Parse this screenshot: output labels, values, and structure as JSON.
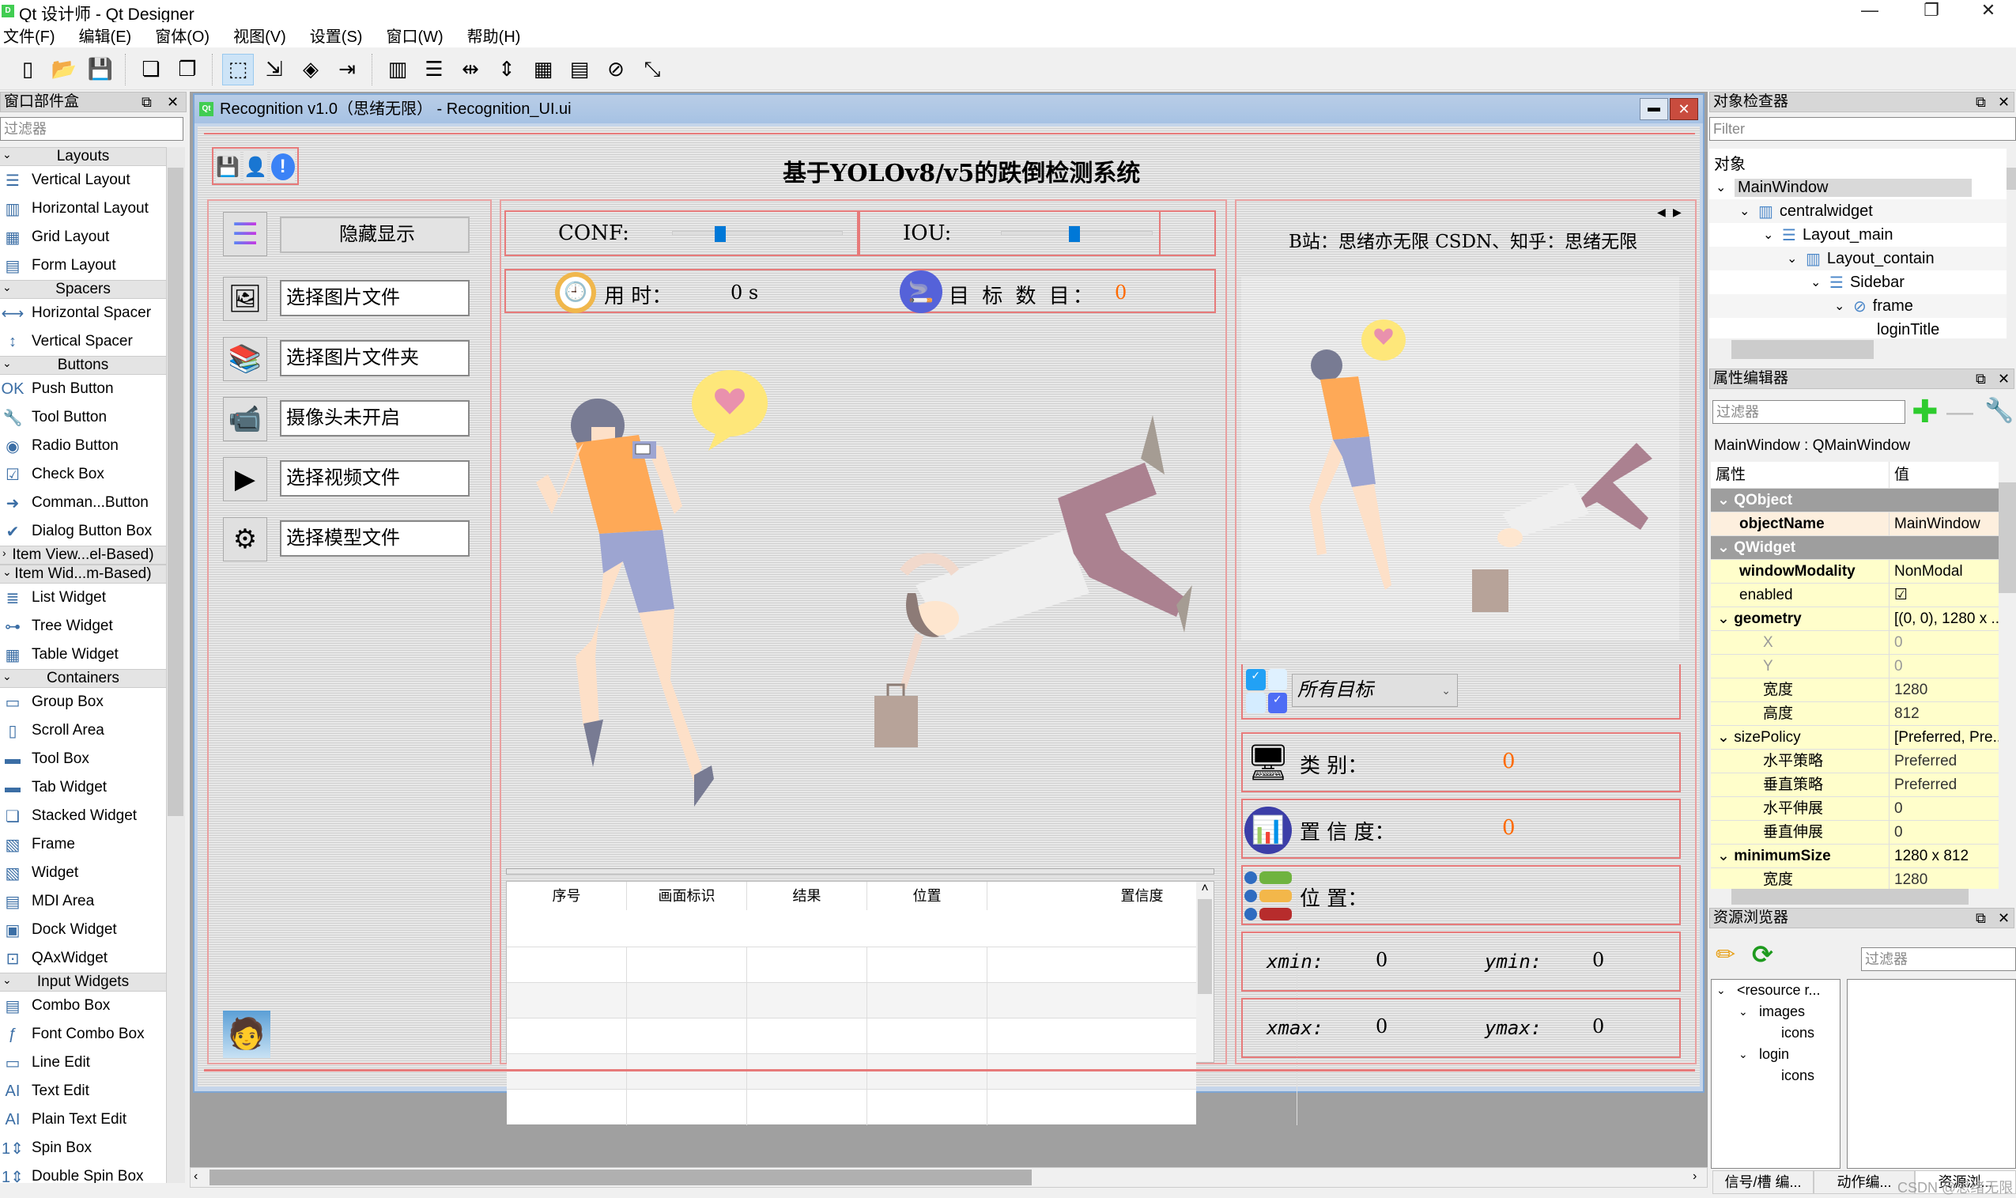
{
  "app": {
    "title": "Qt 设计师 - Qt Designer",
    "icon_label": "D",
    "window_controls": {
      "minimize": "—",
      "maximize": "❐",
      "close": "✕"
    }
  },
  "menubar": [
    "文件(F)",
    "编辑(E)",
    "窗体(O)",
    "视图(V)",
    "设置(S)",
    "窗口(W)",
    "帮助(H)"
  ],
  "toolbar": {
    "groups": [
      [
        {
          "icon": "new-file-icon",
          "glyph": "▯"
        },
        {
          "icon": "open-folder-icon",
          "glyph": "📂"
        },
        {
          "icon": "save-icon",
          "glyph": "💾"
        }
      ],
      [
        {
          "icon": "send-to-back-icon",
          "glyph": "❏"
        },
        {
          "icon": "bring-to-front-icon",
          "glyph": "❐"
        }
      ],
      [
        {
          "icon": "edit-widgets-icon",
          "glyph": "⬚",
          "active": true
        },
        {
          "icon": "edit-signals-slots-icon",
          "glyph": "⇲"
        },
        {
          "icon": "edit-buddies-icon",
          "glyph": "◈"
        },
        {
          "icon": "edit-tab-order-icon",
          "glyph": "⇥"
        }
      ],
      [
        {
          "icon": "layout-horizontal-icon",
          "glyph": "▥"
        },
        {
          "icon": "layout-vertical-icon",
          "glyph": "☰"
        },
        {
          "icon": "layout-horizontal-splitter-icon",
          "glyph": "⇹"
        },
        {
          "icon": "layout-vertical-splitter-icon",
          "glyph": "⇕"
        },
        {
          "icon": "layout-grid-icon",
          "glyph": "▦"
        },
        {
          "icon": "layout-form-icon",
          "glyph": "▤"
        },
        {
          "icon": "break-layout-icon",
          "glyph": "⊘"
        },
        {
          "icon": "adjust-size-icon",
          "glyph": "⤡"
        }
      ]
    ]
  },
  "widget_box": {
    "title": "窗口部件盒",
    "filter_placeholder": "过滤器",
    "sections": [
      {
        "name": "Layouts",
        "expanded": true,
        "items": [
          {
            "label": "Vertical Layout",
            "glyph": "☰"
          },
          {
            "label": "Horizontal Layout",
            "glyph": "▥"
          },
          {
            "label": "Grid Layout",
            "glyph": "▦"
          },
          {
            "label": "Form Layout",
            "glyph": "▤"
          }
        ]
      },
      {
        "name": "Spacers",
        "expanded": true,
        "items": [
          {
            "label": "Horizontal Spacer",
            "glyph": "⟷"
          },
          {
            "label": "Vertical Spacer",
            "glyph": "↕"
          }
        ]
      },
      {
        "name": "Buttons",
        "expanded": true,
        "items": [
          {
            "label": "Push Button",
            "glyph": "OK"
          },
          {
            "label": "Tool Button",
            "glyph": "🔧"
          },
          {
            "label": "Radio Button",
            "glyph": "◉"
          },
          {
            "label": "Check Box",
            "glyph": "☑"
          },
          {
            "label": "Comman...Button",
            "glyph": "➜"
          },
          {
            "label": "Dialog Button Box",
            "glyph": "✔"
          }
        ]
      },
      {
        "name": "Item View...el-Based)",
        "expanded": false,
        "items": []
      },
      {
        "name": "Item Wid...m-Based)",
        "expanded": true,
        "items": [
          {
            "label": "List Widget",
            "glyph": "≣"
          },
          {
            "label": "Tree Widget",
            "glyph": "⊶"
          },
          {
            "label": "Table Widget",
            "glyph": "▦"
          }
        ]
      },
      {
        "name": "Containers",
        "expanded": true,
        "items": [
          {
            "label": "Group Box",
            "glyph": "▭"
          },
          {
            "label": "Scroll Area",
            "glyph": "▯"
          },
          {
            "label": "Tool Box",
            "glyph": "▬"
          },
          {
            "label": "Tab Widget",
            "glyph": "▬"
          },
          {
            "label": "Stacked Widget",
            "glyph": "❏"
          },
          {
            "label": "Frame",
            "glyph": "▧"
          },
          {
            "label": "Widget",
            "glyph": "▧"
          },
          {
            "label": "MDI Area",
            "glyph": "▤"
          },
          {
            "label": "Dock Widget",
            "glyph": "▣"
          },
          {
            "label": "QAxWidget",
            "glyph": "⊡"
          }
        ]
      },
      {
        "name": "Input Widgets",
        "expanded": true,
        "items": [
          {
            "label": "Combo Box",
            "glyph": "▤"
          },
          {
            "label": "Font Combo Box",
            "glyph": "ƒ"
          },
          {
            "label": "Line Edit",
            "glyph": "▭"
          },
          {
            "label": "Text Edit",
            "glyph": "AI"
          },
          {
            "label": "Plain Text Edit",
            "glyph": "AI"
          },
          {
            "label": "Spin Box",
            "glyph": "1⇕"
          },
          {
            "label": "Double Spin Box",
            "glyph": "1⇕"
          }
        ]
      }
    ]
  },
  "form": {
    "window_title": "Recognition v1.0（思绪无限） - Recognition_UI.ui",
    "icon_label": "Qt",
    "header_icons": [
      "save-icon",
      "user-icon",
      "info-icon"
    ],
    "app_title": "基于YOLOv8/v5的跌倒检测系统",
    "sidebar": {
      "menu_button": "隐藏显示",
      "buttons": [
        {
          "label": "选择图片文件",
          "icon": "image-file-icon",
          "glyph": "🖼"
        },
        {
          "label": "选择图片文件夹",
          "icon": "folder-binders-icon",
          "glyph": "📚"
        },
        {
          "label": "摄像头未开启",
          "icon": "camera-icon",
          "glyph": "📹"
        },
        {
          "label": "选择视频文件",
          "icon": "video-file-icon",
          "glyph": "▶"
        },
        {
          "label": "选择模型文件",
          "icon": "model-file-icon",
          "glyph": "⚙"
        }
      ]
    },
    "params": {
      "conf_label": "CONF:",
      "conf_value": 0.25,
      "iou_label": "IOU:",
      "iou_value": 0.45
    },
    "stats": {
      "time_label": "用 时：",
      "time_value": "0 s",
      "count_label": "目 标 数 目：",
      "count_value": "0"
    },
    "table": {
      "headers": [
        "序号",
        "画面标识",
        "结果",
        "位置",
        "置信度"
      ],
      "rows": [
        [
          "",
          "",
          "",
          "",
          ""
        ],
        [
          "",
          "",
          "",
          "",
          ""
        ],
        [
          "",
          "",
          "",
          "",
          ""
        ],
        [
          "",
          "",
          "",
          "",
          ""
        ],
        [
          "",
          "",
          "",
          "",
          ""
        ]
      ]
    },
    "right_panel": {
      "banner": "B站：思绪亦无限  CSDN、知乎：思绪无限",
      "target_select": "所有目标",
      "class_label": "类 别：",
      "class_value": "0",
      "conf_label": "置 信 度：",
      "conf_value": "0",
      "pos_label": "位  置：",
      "xmin_label": "xmin:",
      "xmin_value": "0",
      "ymin_label": "ymin:",
      "ymin_value": "0",
      "xmax_label": "xmax:",
      "xmax_value": "0",
      "ymax_label": "ymax:",
      "ymax_value": "0"
    }
  },
  "object_inspector": {
    "title": "对象检查器",
    "filter_placeholder": "Filter",
    "column": "对象",
    "tree": [
      {
        "label": "MainWindow",
        "depth": 0,
        "expanded": true,
        "icon": "",
        "selected": true
      },
      {
        "label": "centralwidget",
        "depth": 1,
        "expanded": true,
        "icon": "layout-horizontal-icon"
      },
      {
        "label": "Layout_main",
        "depth": 2,
        "expanded": true,
        "icon": "layout-vertical-icon"
      },
      {
        "label": "Layout_contain",
        "depth": 3,
        "expanded": true,
        "icon": "layout-horizontal-icon"
      },
      {
        "label": "Sidebar",
        "depth": 4,
        "expanded": true,
        "icon": "layout-vertical-icon"
      },
      {
        "label": "frame",
        "depth": 5,
        "expanded": true,
        "icon": "break-layout-icon"
      },
      {
        "label": "loginTitle",
        "depth": 6,
        "expanded": null,
        "icon": ""
      }
    ]
  },
  "property_editor": {
    "title": "属性编辑器",
    "filter_placeholder": "过滤器",
    "class_info": "MainWindow : QMainWindow",
    "columns": [
      "属性",
      "值"
    ],
    "rows": [
      {
        "type": "grp",
        "name": "QObject",
        "value": ""
      },
      {
        "type": "obj",
        "name": "objectName",
        "value": "MainWindow",
        "bold": true
      },
      {
        "type": "grp",
        "name": "QWidget",
        "value": ""
      },
      {
        "type": "wid",
        "name": "windowModality",
        "value": "NonModal",
        "bold": true
      },
      {
        "type": "wid",
        "name": "enabled",
        "value": "☑"
      },
      {
        "type": "wid",
        "name": "geometry",
        "value": "[(0, 0), 1280 x ...",
        "bold": true,
        "expander": true
      },
      {
        "type": "wid sub dim",
        "name": "X",
        "value": "0"
      },
      {
        "type": "wid sub dim",
        "name": "Y",
        "value": "0"
      },
      {
        "type": "wid sub",
        "name": "宽度",
        "value": "1280"
      },
      {
        "type": "wid sub",
        "name": "高度",
        "value": "812"
      },
      {
        "type": "wid",
        "name": "sizePolicy",
        "value": "[Preferred, Pre...",
        "expander": true
      },
      {
        "type": "wid sub",
        "name": "水平策略",
        "value": "Preferred"
      },
      {
        "type": "wid sub",
        "name": "垂直策略",
        "value": "Preferred"
      },
      {
        "type": "wid sub",
        "name": "水平伸展",
        "value": "0"
      },
      {
        "type": "wid sub",
        "name": "垂直伸展",
        "value": "0"
      },
      {
        "type": "wid",
        "name": "minimumSize",
        "value": "1280 x 812",
        "bold": true,
        "expander": true
      },
      {
        "type": "wid sub",
        "name": "宽度",
        "value": "1280"
      }
    ]
  },
  "resource_browser": {
    "title": "资源浏览器",
    "filter_placeholder": "过滤器",
    "tree": [
      {
        "label": "<resource r...",
        "depth": 0,
        "expanded": true
      },
      {
        "label": "images",
        "depth": 1,
        "expanded": true
      },
      {
        "label": "icons",
        "depth": 2,
        "expanded": null
      },
      {
        "label": "login",
        "depth": 1,
        "expanded": true
      },
      {
        "label": "icons",
        "depth": 2,
        "expanded": null
      }
    ],
    "tabs": [
      "信号/槽 编...",
      "动作编...",
      "资源浏..."
    ],
    "active_tab": 2
  },
  "watermark": "CSDN @思绪无限",
  "colors": {
    "layout_border": "#e77a7a",
    "slider_thumb": "#0078d7",
    "value_orange": "#ff6a00",
    "group_row": "#9e9e9e",
    "qwidget_row": "#fffecb",
    "qobject_row": "#fdefde"
  }
}
